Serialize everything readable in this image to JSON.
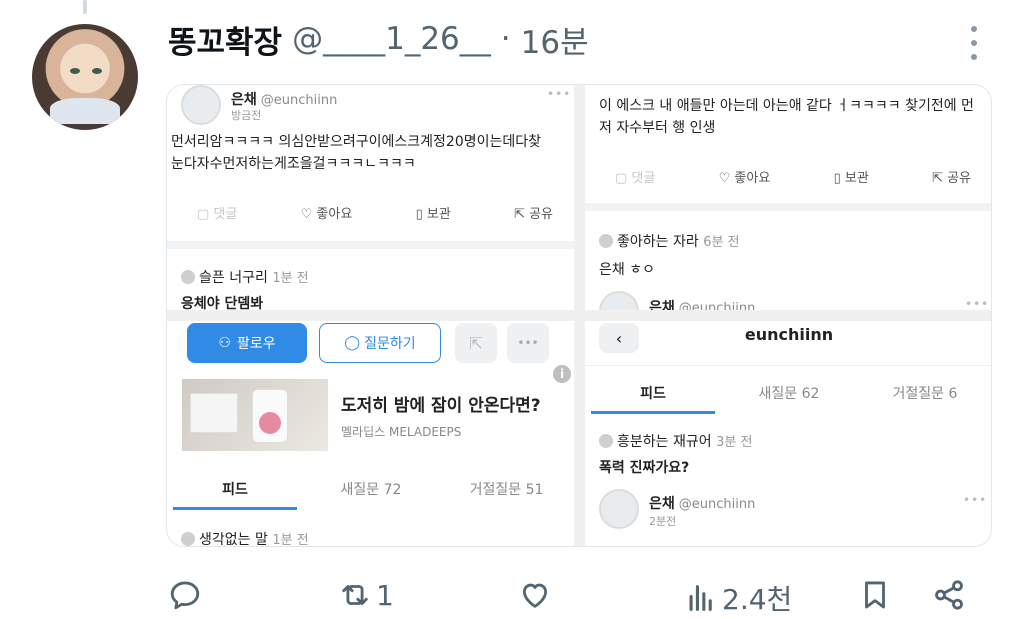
{
  "tweet": {
    "display_name": "똥꼬확장",
    "handle": "@____1_26__",
    "separator": "·",
    "time": "16분"
  },
  "panel1": {
    "name": "은채",
    "handle": "@eunchiinn",
    "sub": "방금전",
    "text_line1": "먼서리암ㅋㅋㅋㅋ 의심안받으려구이에스크계정20명이는데다찾",
    "text_line2": "눈다자수먼저하는게조을걸ㅋㅋㅋㄴㅋㅋㅋ",
    "actions": [
      "댓글",
      "좋아요",
      "보관",
      "공유"
    ],
    "q_author": "슬픈 너구리",
    "q_ago": "1분 전",
    "q_text": "응체야 단뎀봐"
  },
  "panel2": {
    "text_line1": "이 에스크 내 애들만 아는데 아는애 같다 ㅓㅋㅋㅋㅋ 찾기전에 먼",
    "text_line2": "저 자수부터 행 인생",
    "actions": [
      "댓글",
      "좋아요",
      "보관",
      "공유"
    ],
    "q_author": "좋아하는 자라",
    "q_ago": "6분 전",
    "q_text": "은채 ㅎㅇ",
    "name": "은채",
    "handle": "@eunchiinn"
  },
  "panel3": {
    "follow_label": "팔로우",
    "ask_label": "질문하기",
    "ad_title": "도저히 밤에 잠이 안온다면?",
    "ad_sub": "멜라딥스 MELADEEPS",
    "tabs": [
      "피드",
      "새질문 72",
      "거절질문 51"
    ],
    "q_author": "생각없는 말",
    "q_ago": "1분 전"
  },
  "panel4": {
    "profile_name": "eunchiinn",
    "tabs": [
      "피드",
      "새질문 62",
      "거절질문 6"
    ],
    "q_author": "흥분하는 재규어",
    "q_ago": "3분 전",
    "q_text": "폭력 진짜가요?",
    "name": "은채",
    "handle": "@eunchiinn",
    "sub": "2분전"
  },
  "actions": {
    "retweet_count": "1",
    "views_count": "2.4천"
  }
}
